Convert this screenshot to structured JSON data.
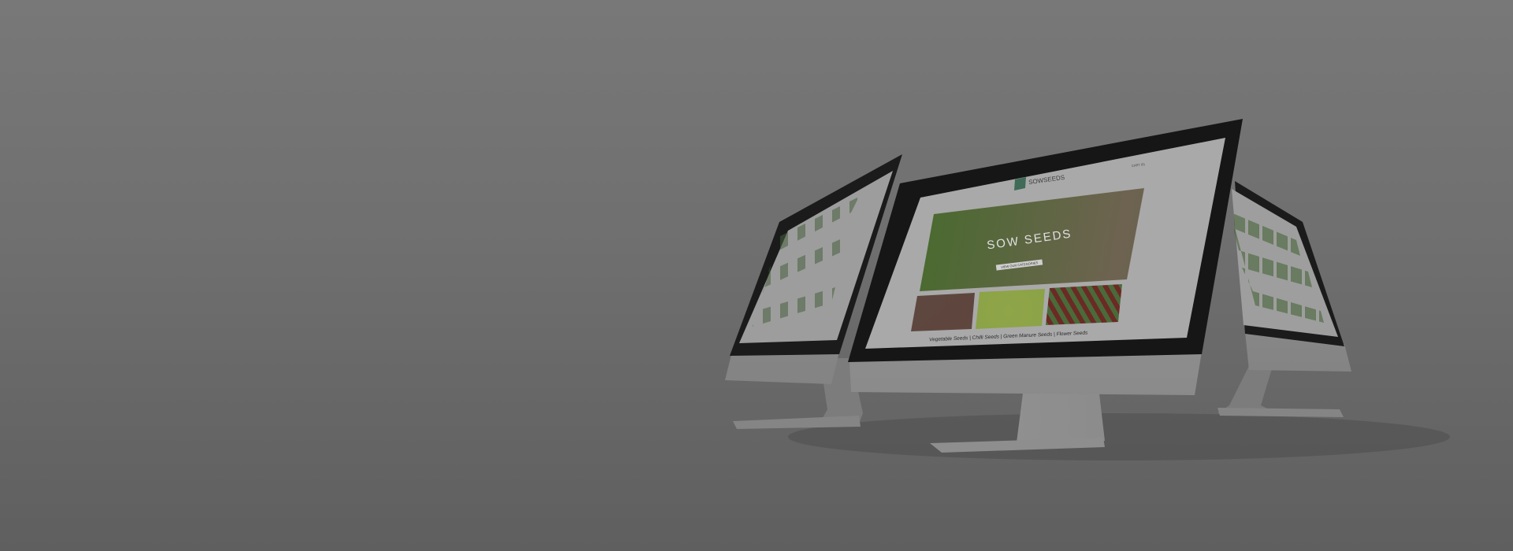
{
  "scene": {
    "description_colors": {
      "background": "#737373",
      "screen": "#a8a8a8",
      "bezel": "#1a1a1a",
      "aluminum": "#8a8a8a",
      "accent": "#3f6b57"
    }
  },
  "main_screen": {
    "logo_text": "SOWSEEDS",
    "cart_label": "CART (0)",
    "hero_title": "SOW SEEDS",
    "hero_button": "VIEW OUR CATEGORIES",
    "caption": "Vegetable Seeds | Chilli Seeds | Green Manure Seeds | Flower Seeds"
  }
}
